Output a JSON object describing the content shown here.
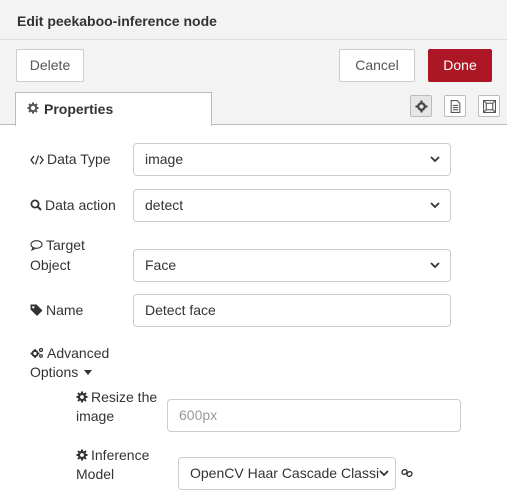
{
  "dialog": {
    "title": "Edit peekaboo-inference node"
  },
  "toolbar": {
    "delete_label": "Delete",
    "cancel_label": "Cancel",
    "done_label": "Done",
    "done_color": "#ad1625"
  },
  "tabs": {
    "properties_label": "Properties",
    "icons": [
      "gear-icon",
      "document-icon",
      "frame-icon"
    ]
  },
  "form": {
    "data_type": {
      "label": "Data Type",
      "icon": "code-icon",
      "value": "image"
    },
    "data_action": {
      "label": "Data action",
      "icon": "search-icon",
      "value": "detect"
    },
    "target_object": {
      "label_line1": "Target",
      "label_line2": "Object",
      "icon": "comment-icon",
      "value": "Face"
    },
    "name": {
      "label": "Name",
      "icon": "tag-icon",
      "value": "Detect face"
    },
    "advanced": {
      "label_line1": "Advanced",
      "label_line2": "Options",
      "icon": "gears-icon"
    },
    "resize": {
      "label_line1": "Resize the",
      "label_line2": "image",
      "icon": "gear-icon",
      "placeholder": "600px"
    },
    "inference_model": {
      "label_line1": "Inference",
      "label_line2": "Model",
      "icon": "gear-icon",
      "value": "OpenCV Haar Cascade Classi"
    }
  }
}
